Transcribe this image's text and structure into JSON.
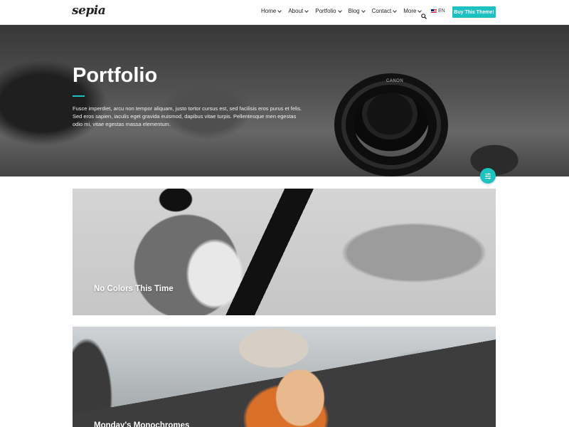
{
  "header": {
    "logo_text": "sepia",
    "nav": [
      {
        "label": "Home",
        "has_dropdown": true
      },
      {
        "label": "About",
        "has_dropdown": true
      },
      {
        "label": "Portfolio",
        "has_dropdown": true
      },
      {
        "label": "Blog",
        "has_dropdown": true
      },
      {
        "label": "Contact",
        "has_dropdown": true
      },
      {
        "label": "More",
        "has_dropdown": true
      }
    ],
    "search_icon": "search-icon",
    "language": "EN",
    "buy_button": "Buy This Theme!"
  },
  "hero": {
    "title": "Portfolio",
    "text": "Fusce imperdiet, arcu non tempor aliquam, justo tortor cursus est, sed facilisis eros purus et felis. Sed eros sapien, iaculis eget gravida euismod, dapibus vitae turpis. Pellentesque men egestas odio mi, vitae egestas massa elementum.",
    "lens_brand": "CANON"
  },
  "filter_button": {
    "icon": "sliders-icon"
  },
  "portfolio": {
    "items": [
      {
        "title": "No Colors This Time"
      },
      {
        "title": "Monday's Monochromes"
      }
    ]
  },
  "colors": {
    "accent": "#1ec1c1",
    "header_bg": "#ffffff",
    "text_dark": "#222222"
  }
}
